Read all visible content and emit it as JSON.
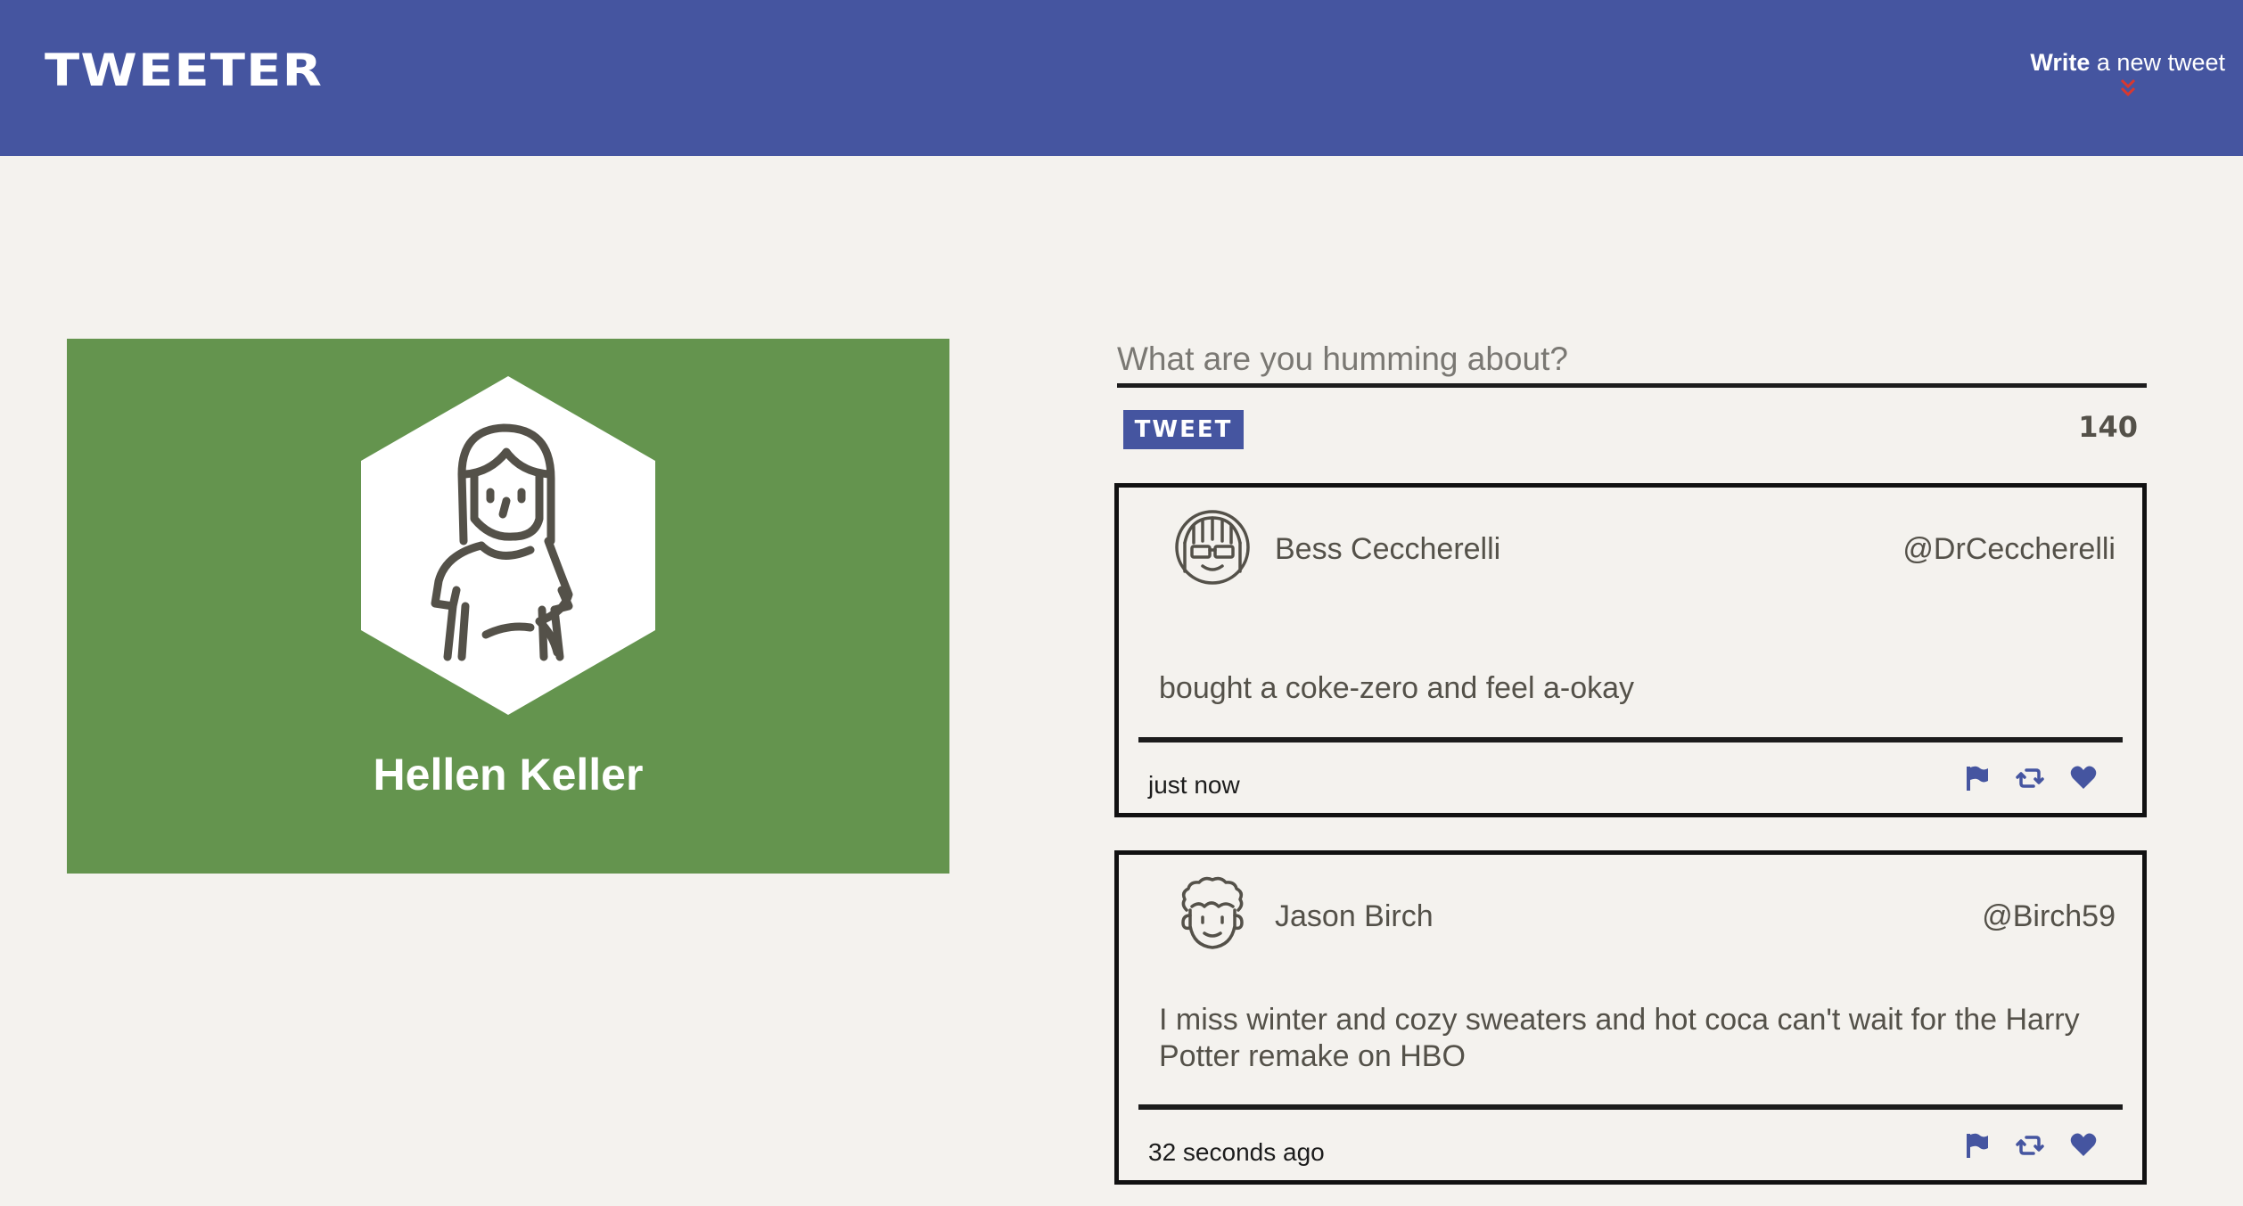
{
  "nav": {
    "brand": "TWEETER",
    "compose_bold": "Write",
    "compose_rest": " a new tweet",
    "compose_icon": "double-chevron-down-icon",
    "compose_icon_color": "#d9382f"
  },
  "colors": {
    "nav_bg": "#4555a0",
    "page_bg": "#f4f2ee",
    "profile_bg": "#64944e",
    "accent": "#4555a0",
    "text": "#545149"
  },
  "profile": {
    "name": "Hellen Keller",
    "avatar_icon": "woman-avatar-icon"
  },
  "composer": {
    "placeholder": "What are you humming about?",
    "value": "",
    "button_label": "TWEET",
    "counter": "140"
  },
  "tweets": [
    {
      "name": "Bess Ceccherelli",
      "handle": "@DrCeccherelli",
      "text": "bought a coke-zero and feel a-okay",
      "time": "just now",
      "avatar_icon": "girl-glasses-avatar-icon"
    },
    {
      "name": "Jason Birch",
      "handle": "@Birch59",
      "text": "I miss winter and cozy sweaters and hot coca can't wait for the Harry Potter remake on HBO",
      "time": "32 seconds ago",
      "avatar_icon": "curly-hair-avatar-icon"
    }
  ],
  "tweet_actions": [
    "flag-icon",
    "retweet-icon",
    "heart-icon"
  ]
}
